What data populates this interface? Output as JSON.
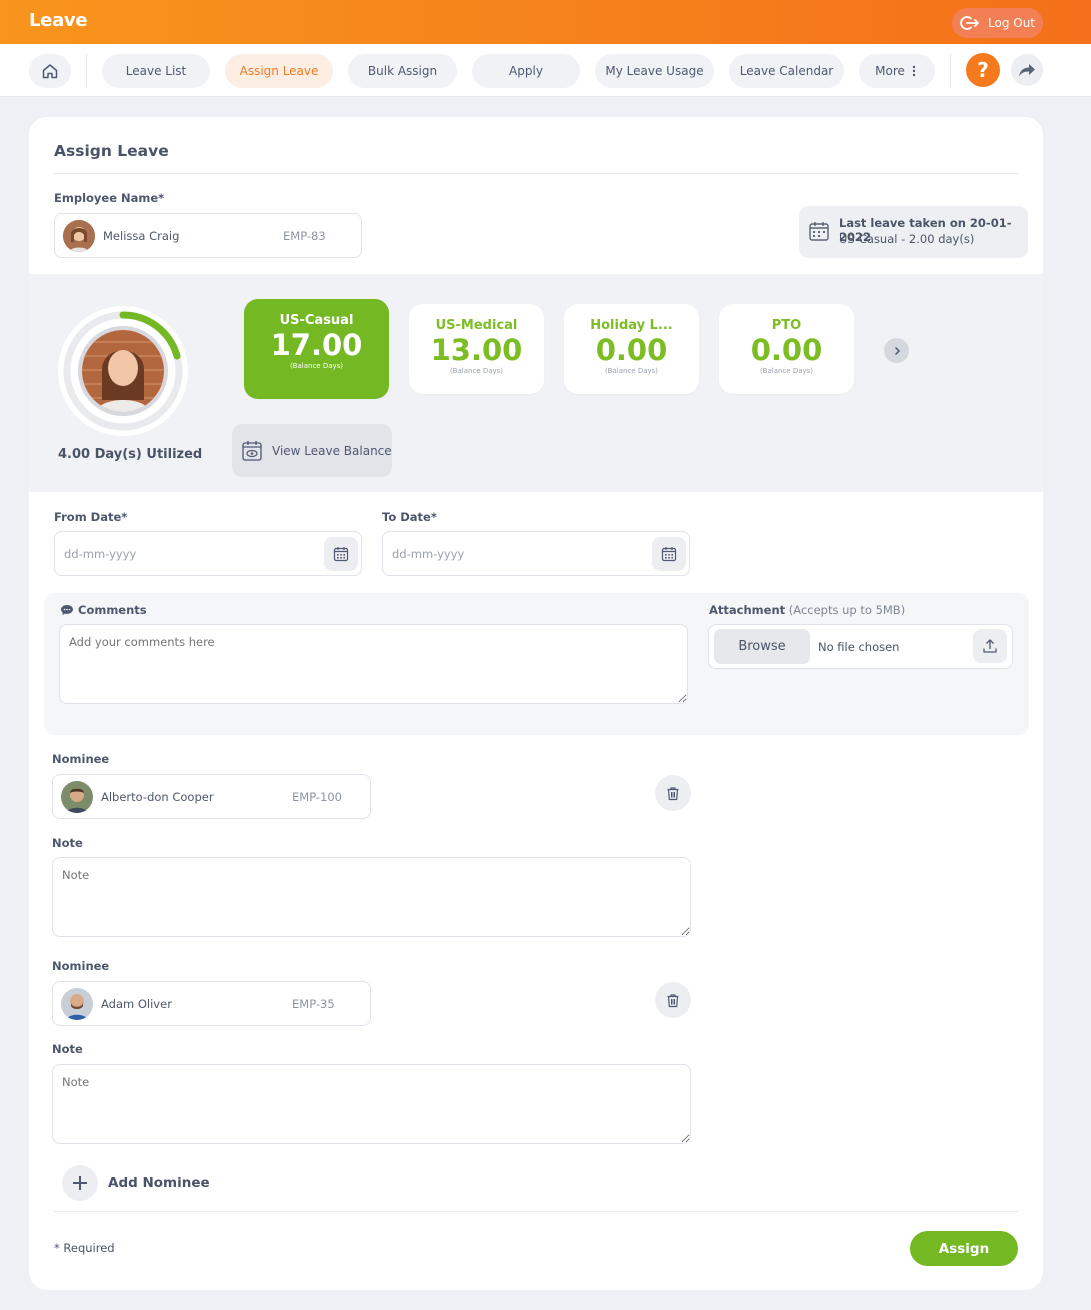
{
  "app": {
    "title": "Leave",
    "logout_label": "Log Out"
  },
  "nav": {
    "tabs": [
      {
        "label": "Leave List"
      },
      {
        "label": "Assign Leave"
      },
      {
        "label": "Bulk Assign"
      },
      {
        "label": "Apply"
      },
      {
        "label": "My Leave Usage"
      },
      {
        "label": "Leave Calendar"
      },
      {
        "label": "More"
      }
    ],
    "help_glyph": "?",
    "active_color": "#f47a22"
  },
  "page": {
    "title": "Assign Leave"
  },
  "employee": {
    "label": "Employee Name*",
    "name": "Melissa Craig",
    "id": "EMP-83",
    "last_leave_title": "Last leave taken on 20-01-2022",
    "last_leave_detail": "US-Casual - 2.00 day(s)",
    "utilized": "4.00 Day(s) Utilized"
  },
  "balances": [
    {
      "type": "US-Casual",
      "value": "17.00",
      "sub": "(Balance Days)"
    },
    {
      "type": "US-Medical",
      "value": "13.00",
      "sub": "(Balance Days)"
    },
    {
      "type": "Holiday L...",
      "value": "0.00",
      "sub": "(Balance Days)"
    },
    {
      "type": "PTO",
      "value": "0.00",
      "sub": "(Balance Days)"
    }
  ],
  "view_balance_label": "View Leave Balance",
  "dates": {
    "from_label": "From Date*",
    "to_label": "To Date*",
    "placeholder": "dd-mm-yyyy"
  },
  "comments": {
    "label": "Comments",
    "placeholder": "Add your comments here"
  },
  "attachment": {
    "label": "Attachment",
    "hint": "(Accepts up to 5MB)",
    "browse_label": "Browse",
    "file_status": "No file chosen"
  },
  "nominees": [
    {
      "label": "Nominee",
      "name": "Alberto-don Cooper",
      "id": "EMP-100",
      "note_label": "Note",
      "note_placeholder": "Note"
    },
    {
      "label": "Nominee",
      "name": "Adam Oliver",
      "id": "EMP-35",
      "note_label": "Note",
      "note_placeholder": "Note"
    }
  ],
  "add_nominee_label": "Add Nominee",
  "footer": {
    "required_note": "* Required",
    "assign_label": "Assign"
  },
  "colors": {
    "brand_orange": "#f47a1b",
    "green": "#74b924"
  }
}
